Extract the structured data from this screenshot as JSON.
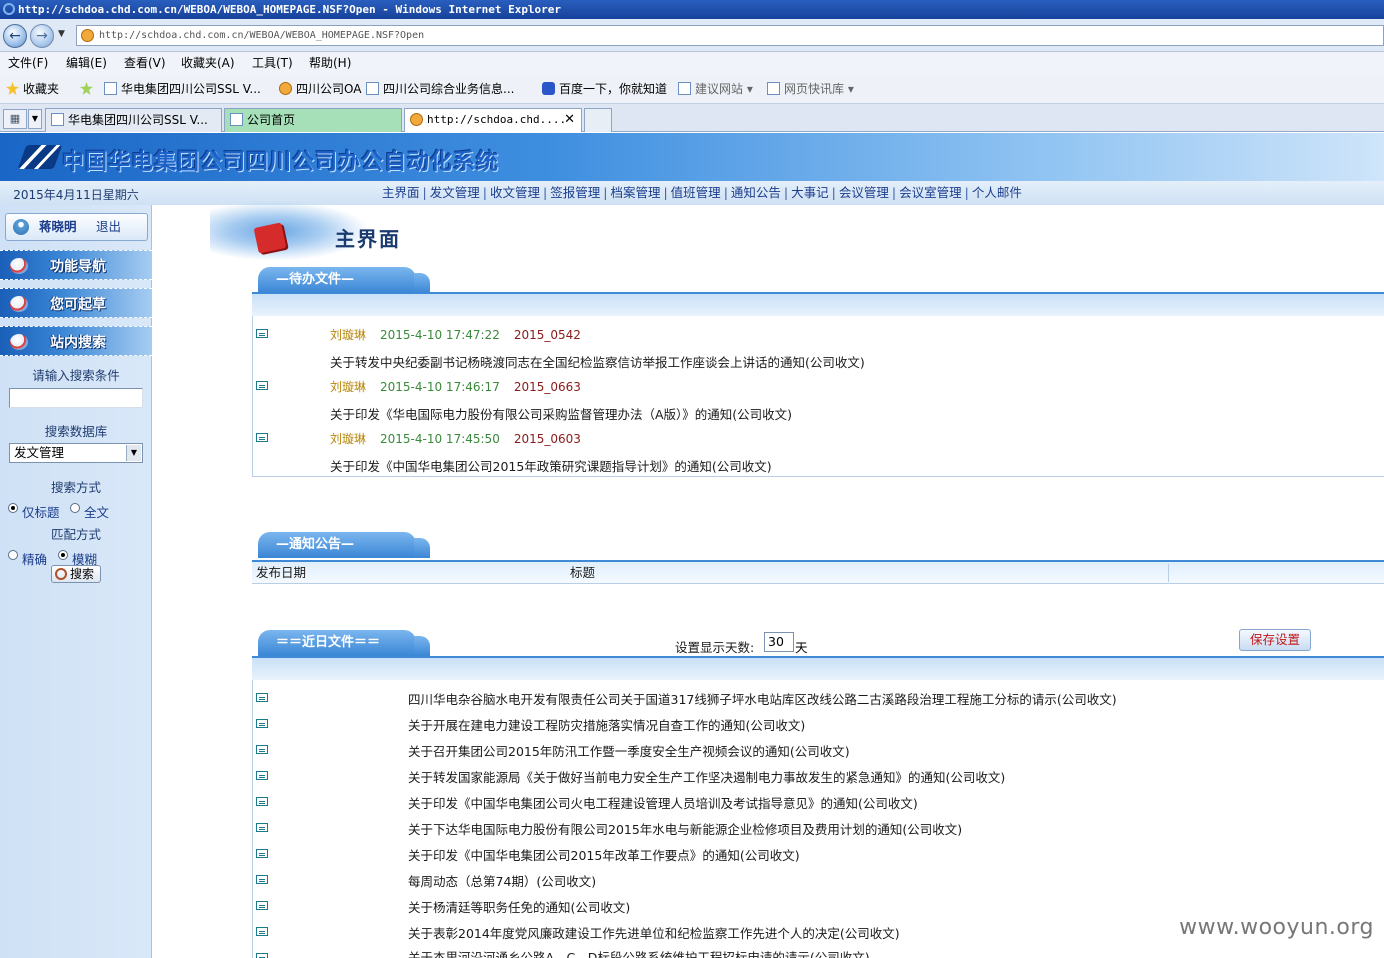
{
  "window": {
    "title": "http://schdoa.chd.com.cn/WEBOA/WEBOA_HOMEPAGE.NSF?Open - Windows Internet Explorer",
    "address": "http://schdoa.chd.com.cn/WEBOA/WEBOA_HOMEPAGE.NSF?Open"
  },
  "menu": [
    "文件(F)",
    "编辑(E)",
    "查看(V)",
    "收藏夹(A)",
    "工具(T)",
    "帮助(H)"
  ],
  "favorites": {
    "label": "收藏夹",
    "items": [
      "华电集团四川公司SSL V...",
      "四川公司OA",
      "四川公司综合业务信息...",
      "百度一下，你就知道",
      "建议网站 ▾",
      "网页快讯库 ▾"
    ]
  },
  "tabs": [
    "华电集团四川公司SSL V...",
    "公司首页",
    "http://schdoa.chd...."
  ],
  "app": {
    "title": "中国华电集团公司四川公司办公自动化系统",
    "date": "2015年4月11日星期六",
    "nav": [
      "主界面",
      "发文管理",
      "收文管理",
      "签报管理",
      "档案管理",
      "值班管理",
      "通知公告",
      "大事记",
      "会议管理",
      "会议室管理",
      "个人邮件"
    ]
  },
  "sidebar": {
    "user": "蒋晓明",
    "logout": "退出",
    "headers": [
      "功能导航",
      "您可起草",
      "站内搜索"
    ],
    "search_prompt": "请输入搜索条件",
    "search_value": "",
    "db_label": "搜索数据库",
    "db_value": "发文管理",
    "mode_label": "搜索方式",
    "mode_title": "仅标题",
    "mode_full": "全文",
    "match_label": "匹配方式",
    "match_exact": "精确",
    "match_fuzzy": "模糊",
    "search_button": "搜索"
  },
  "main": {
    "page_title": "主界面",
    "pending": {
      "tab": "—待办文件—",
      "items": [
        {
          "author": "刘璇琳",
          "time": "2015-4-10 17:47:22",
          "number": "2015_0542",
          "title": "关于转发中央纪委副书记杨晓渡同志在全国纪检监察信访举报工作座谈会上讲话的通知(公司收文)"
        },
        {
          "author": "刘璇琳",
          "time": "2015-4-10 17:46:17",
          "number": "2015_0663",
          "title": "关于印发《华电国际电力股份有限公司采购监督管理办法（A版）》的通知(公司收文)"
        },
        {
          "author": "刘璇琳",
          "time": "2015-4-10 17:45:50",
          "number": "2015_0603",
          "title": "关于印发《中国华电集团公司2015年政策研究课题指导计划》的通知(公司收文)"
        }
      ]
    },
    "notice": {
      "tab": "—通知公告—",
      "col_date": "发布日期",
      "col_title": "标题"
    },
    "recent": {
      "tab": "＝＝近日文件＝＝",
      "days_label": "设置显示天数:",
      "days_value": "30",
      "days_unit": "天",
      "save_button": "保存设置",
      "items": [
        "四川华电杂谷脑水电开发有限责任公司关于国道317线狮子坪水电站库区改线公路二古溪路段治理工程施工分标的请示(公司收文)",
        "关于开展在建电力建设工程防灾措施落实情况自查工作的通知(公司收文)",
        "关于召开集团公司2015年防汛工作暨一季度安全生产视频会议的通知(公司收文)",
        "关于转发国家能源局《关于做好当前电力安全生产工作坚决遏制电力事故发生的紧急通知》的通知(公司收文)",
        "关于印发《中国华电集团公司火电工程建设管理人员培训及考试指导意见》的通知(公司收文)",
        "关于下达华电国际电力股份有限公司2015年水电与新能源企业检修项目及费用计划的通知(公司收文)",
        "关于印发《中国华电集团公司2015年改革工作要点》的通知(公司收文)",
        "每周动态（总第74期）(公司收文)",
        "关于杨清廷等职务任免的通知(公司收文)",
        "关于表彰2014年度党风廉政建设工作先进单位和纪检监察工作先进个人的决定(公司收文)",
        "关于杰里河沿河通乡公路A、C、D标段公路系统维护工程招标申请的请示(公司收文)"
      ]
    }
  },
  "watermark": "www.wooyun.org"
}
